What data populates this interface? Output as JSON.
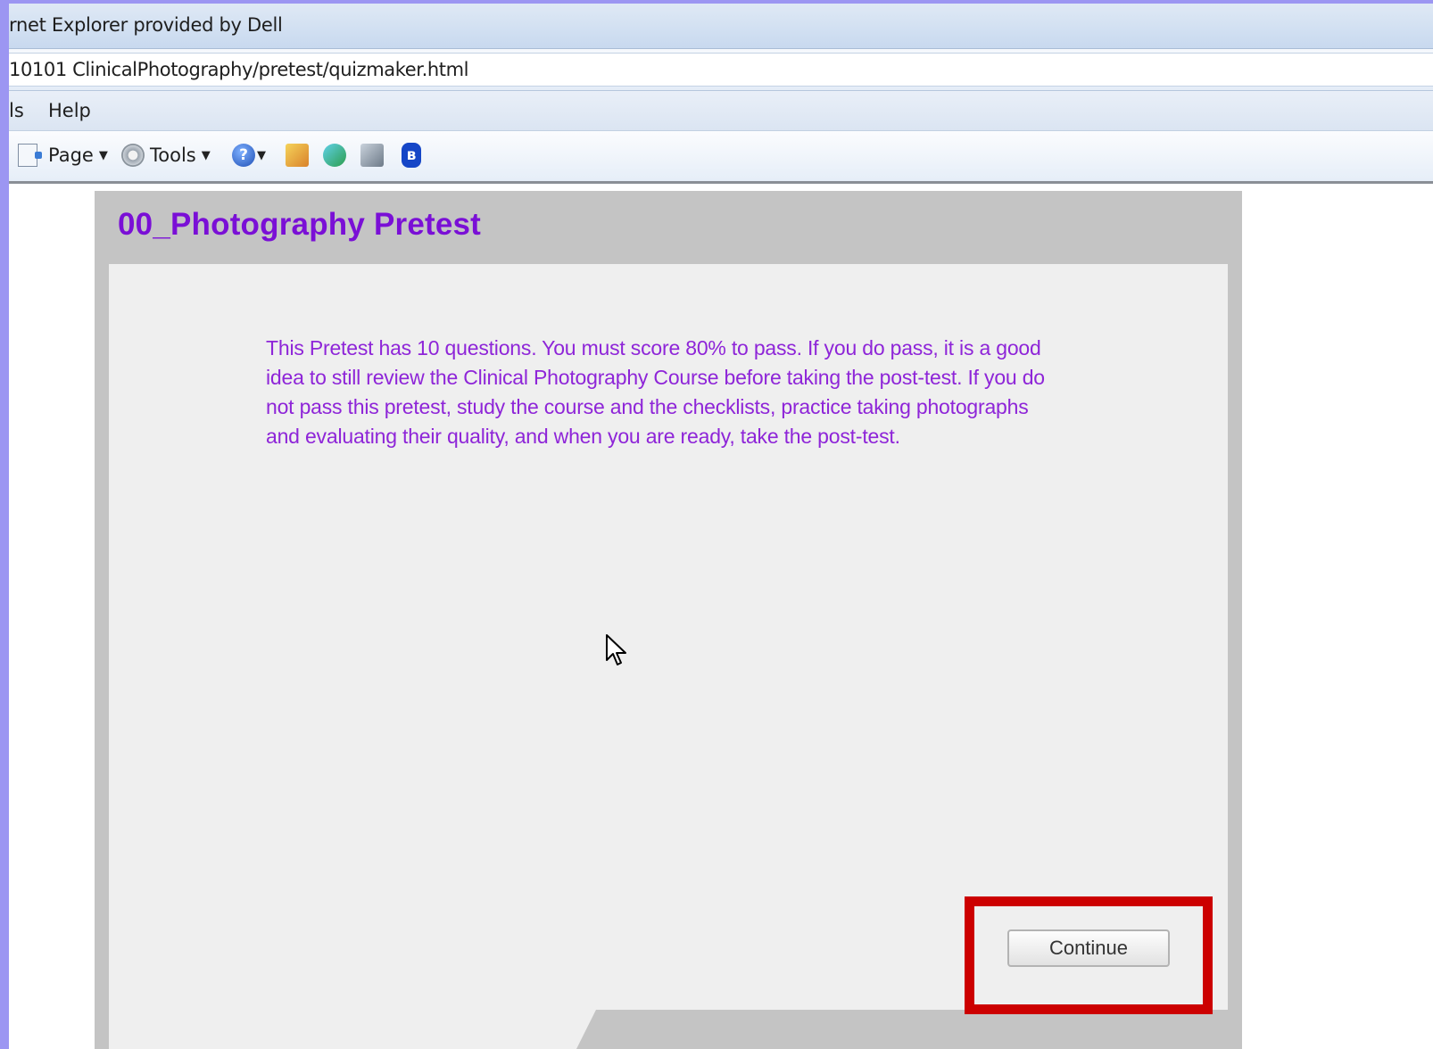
{
  "browser": {
    "title": "rnet Explorer provided by Dell",
    "address": "10101 ClinicalPhotography/pretest/quizmaker.html",
    "menu": [
      {
        "label": "ls"
      },
      {
        "label": "Help"
      }
    ],
    "command_bar": {
      "page_label": "Page",
      "tools_label": "Tools",
      "help_glyph": "?",
      "bluetooth_glyph": "ʙ",
      "icons": [
        "page-icon",
        "gear-icon",
        "help-icon",
        "research-icon",
        "messenger-icon",
        "clipboard-icon",
        "bluetooth-icon"
      ]
    }
  },
  "quiz": {
    "title": "00_Photography Pretest",
    "intro": "This Pretest has 10 questions. You must score 80% to pass. If you do pass, it is a good idea to still review the Clinical Photography Course before taking the post-test.  If you do not pass this pretest, study the course and the checklists, practice taking photographs and evaluating their quality, and when you are ready, take the post-test.",
    "continue_label": "Continue"
  },
  "colors": {
    "title": "#7a0fd6",
    "text": "#8e25d8",
    "highlight": "#cc0000",
    "slide_background": "#9c96f2"
  }
}
